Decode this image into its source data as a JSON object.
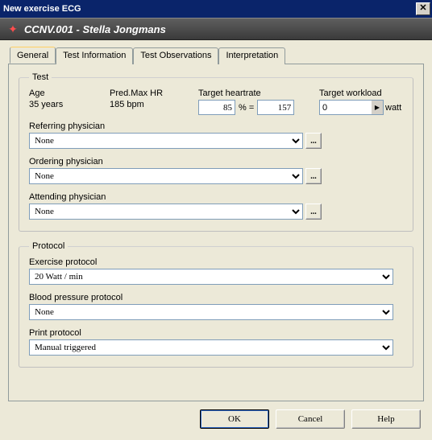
{
  "window": {
    "title": "New exercise ECG",
    "close_glyph": "✕"
  },
  "header": {
    "icon_glyph": "✦",
    "text": "CCNV.001 - Stella Jongmans"
  },
  "tabs": [
    {
      "label": "General",
      "active": true
    },
    {
      "label": "Test Information",
      "active": false
    },
    {
      "label": "Test Observations",
      "active": false
    },
    {
      "label": "Interpretation",
      "active": false
    }
  ],
  "test": {
    "legend": "Test",
    "age_label": "Age",
    "age_value": "35 years",
    "predmax_label": "Pred.Max HR",
    "predmax_value": "185 bpm",
    "thr_label": "Target heartrate",
    "thr_pct": "85",
    "thr_mid": "% =",
    "thr_val": "157",
    "tw_label": "Target workload",
    "tw_value": "0",
    "tw_arrow": "▶",
    "tw_unit": "watt",
    "ref_label": "Referring physician",
    "ref_value": "None",
    "ord_label": "Ordering physician",
    "ord_value": "None",
    "att_label": "Attending physician",
    "att_value": "None",
    "ellipsis": "..."
  },
  "protocol": {
    "legend": "Protocol",
    "ex_label": "Exercise protocol",
    "ex_value": "20 Watt / min",
    "bp_label": "Blood pressure protocol",
    "bp_value": "None",
    "print_label": "Print protocol",
    "print_value": "Manual triggered"
  },
  "buttons": {
    "ok": "OK",
    "cancel": "Cancel",
    "help": "Help"
  }
}
